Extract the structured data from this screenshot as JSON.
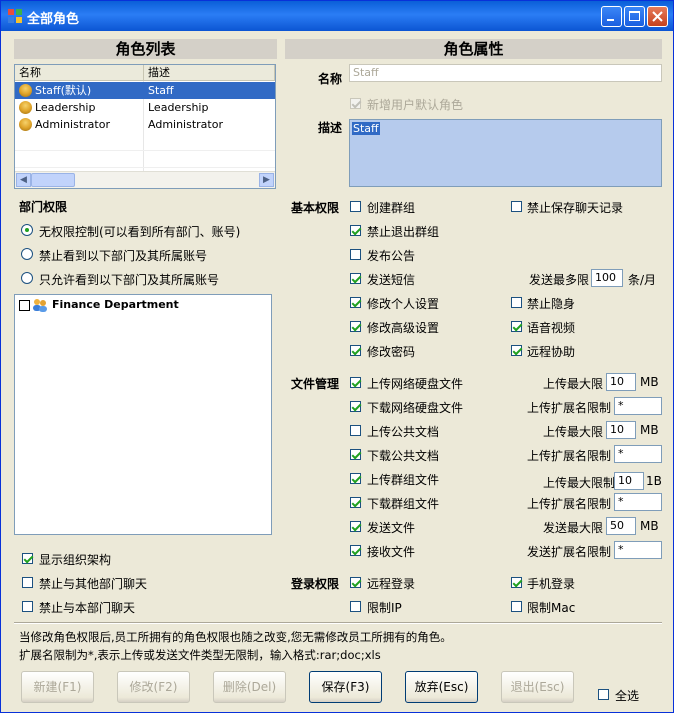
{
  "window": {
    "title": "全部角色"
  },
  "role_list": {
    "header": "角色列表",
    "columns": [
      "名称",
      "描述"
    ],
    "rows": [
      {
        "name": "Staff(默认)",
        "desc": "Staff",
        "selected": true
      },
      {
        "name": "Leadership",
        "desc": "Leadership",
        "selected": false
      },
      {
        "name": "Administrator",
        "desc": "Administrator",
        "selected": false
      }
    ]
  },
  "dept": {
    "title": "部门权限",
    "options": [
      "无权限控制(可以看到所有部门、账号)",
      "禁止看到以下部门及其所属账号",
      "只允许看到以下部门及其所属账号"
    ],
    "selected_option": 0,
    "tree_item": "Finance Department"
  },
  "left_checks": [
    {
      "label": "显示组织架构",
      "checked": true
    },
    {
      "label": "禁止与其他部门聊天",
      "checked": false
    },
    {
      "label": "禁止与本部门聊天",
      "checked": false
    }
  ],
  "attrs": {
    "header": "角色属性",
    "name_label": "名称",
    "name_value": "Staff",
    "default_role_label": "新增用户默认角色",
    "desc_label": "描述",
    "desc_value": "Staff"
  },
  "basic": {
    "title": "基本权限",
    "items": [
      {
        "label": "创建群组",
        "checked": false
      },
      {
        "label": "禁止保存聊天记录",
        "checked": false
      },
      {
        "label": "禁止退出群组",
        "checked": true
      },
      {
        "label": "发布公告",
        "checked": false
      },
      {
        "label": "发送短信",
        "checked": true
      },
      {
        "label": "修改个人设置",
        "checked": true
      },
      {
        "label": "禁止隐身",
        "checked": false
      },
      {
        "label": "修改高级设置",
        "checked": true
      },
      {
        "label": "语音视频",
        "checked": true
      },
      {
        "label": "修改密码",
        "checked": true
      },
      {
        "label": "远程协助",
        "checked": true
      }
    ],
    "sms_limit_label": "发送最多限",
    "sms_limit_value": "100",
    "sms_limit_unit": "条/月"
  },
  "files": {
    "title": "文件管理",
    "items": [
      {
        "label": "上传网络硬盘文件",
        "checked": true,
        "right_label": "上传最大限",
        "value": "10",
        "unit": "MB"
      },
      {
        "label": "下载网络硬盘文件",
        "checked": true,
        "right_label": "上传扩展名限制",
        "value": "*",
        "unit": ""
      },
      {
        "label": "上传公共文档",
        "checked": false,
        "right_label": "上传最大限",
        "value": "10",
        "unit": "MB"
      },
      {
        "label": "下载公共文档",
        "checked": true,
        "right_label": "上传扩展名限制",
        "value": "*",
        "unit": ""
      },
      {
        "label": "上传群组文件",
        "checked": true,
        "right_label": "上传最大限制",
        "value": "10",
        "unit": "1B"
      },
      {
        "label": "下载群组文件",
        "checked": true,
        "right_label": "上传扩展名限制",
        "value": "*",
        "unit": ""
      },
      {
        "label": "发送文件",
        "checked": true,
        "right_label": "发送最大限",
        "value": "50",
        "unit": "MB"
      },
      {
        "label": "接收文件",
        "checked": true,
        "right_label": "发送扩展名限制",
        "value": "*",
        "unit": ""
      }
    ]
  },
  "login": {
    "title": "登录权限",
    "items": [
      {
        "label": "远程登录",
        "checked": true
      },
      {
        "label": "手机登录",
        "checked": true
      },
      {
        "label": "限制IP",
        "checked": false
      },
      {
        "label": "限制Mac",
        "checked": false
      }
    ]
  },
  "notes": {
    "line1": "当修改角色权限后,员工所拥有的角色权限也随之改变,您无需修改员工所拥有的角色。",
    "line2": "扩展名限制为*,表示上传或发送文件类型无限制，输入格式:rar;doc;xls"
  },
  "buttons": {
    "new": "新建(F1)",
    "edit": "修改(F2)",
    "delete": "删除(Del)",
    "save": "保存(F3)",
    "discard": "放弃(Esc)",
    "exit": "退出(Esc)",
    "select_all": "全选"
  }
}
